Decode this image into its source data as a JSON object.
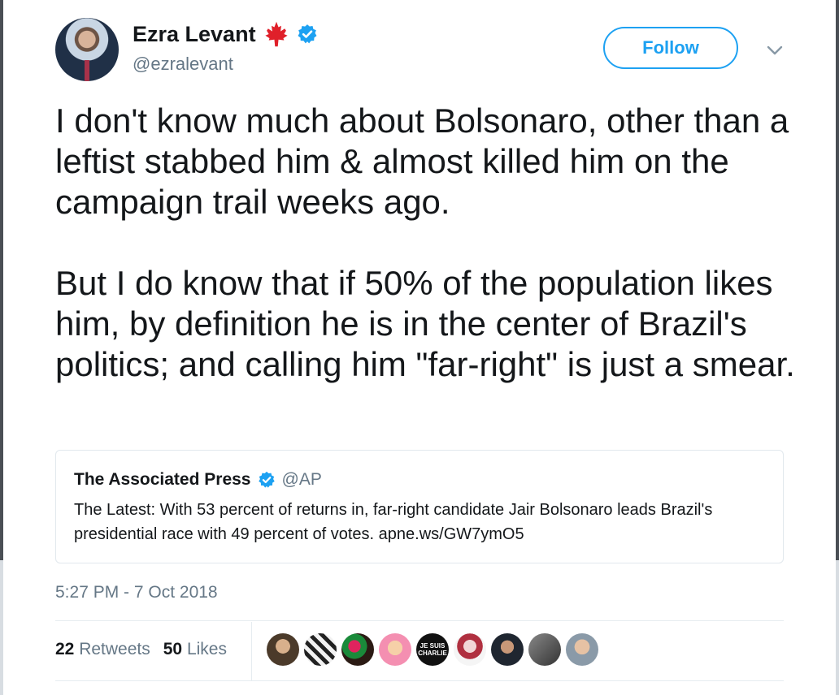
{
  "author": {
    "name": "Ezra Levant",
    "handle": "@ezralevant",
    "badges": [
      "maple-leaf-icon",
      "verified-icon"
    ]
  },
  "header": {
    "follow_label": "Follow",
    "menu_icon": "chevron-down-icon"
  },
  "tweet": {
    "paragraphs": [
      "I don't know much about Bolsonaro, other than a leftist stabbed him & almost killed him on the campaign trail weeks ago.",
      "But I do know that if 50% of the population likes him, by definition he is in the center of Brazil's politics; and calling him \"far-right\" is just a smear."
    ],
    "timestamp": "5:27 PM - 7 Oct 2018"
  },
  "quoted_tweet": {
    "name": "The Associated Press",
    "handle": "@AP",
    "text": "The Latest: With 53 percent of returns in, far-right candidate Jair Bolsonaro leads Brazil's presidential race with 49 percent of votes. apne.ws/GW7ymO5"
  },
  "stats": {
    "retweets_count": "22",
    "retweets_label": "Retweets",
    "likes_count": "50",
    "likes_label": "Likes"
  },
  "likers": {
    "count": 9,
    "badge_text_je_suis": "JE SUIS",
    "badge_text_charlie": "CHARLIE"
  },
  "colors": {
    "accent": "#1da1f2",
    "text": "#14171a",
    "secondary": "#657786",
    "maple": "#e0202a"
  }
}
